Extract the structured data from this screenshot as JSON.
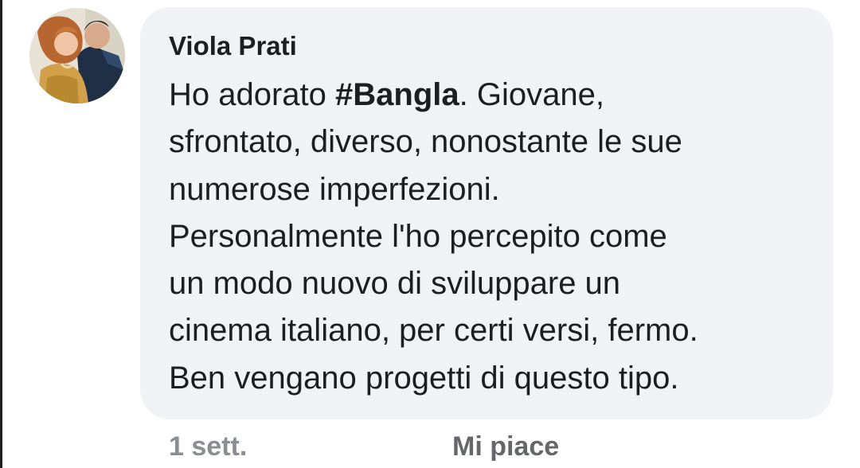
{
  "comment": {
    "author": "Viola Prati",
    "line1_before": "Ho adorato ",
    "hashtag": "#Bangla",
    "line1_after": ". Giovane,",
    "lines": [
      "sfrontato, diverso, nonostante le sue",
      "numerose imperfezioni.",
      "Personalmente l'ho percepito come",
      "un modo nuovo di sviluppare un",
      "cinema italiano, per certi versi, fermo.",
      "Ben vengano progetti di questo tipo."
    ]
  },
  "actions": {
    "timestamp": "1 sett.",
    "like_label": "Mi piace"
  },
  "colors": {
    "bubble": "#f0f2f5",
    "text": "#1c1e21",
    "timestamp": "#8a8d91",
    "action": "#65676b"
  }
}
